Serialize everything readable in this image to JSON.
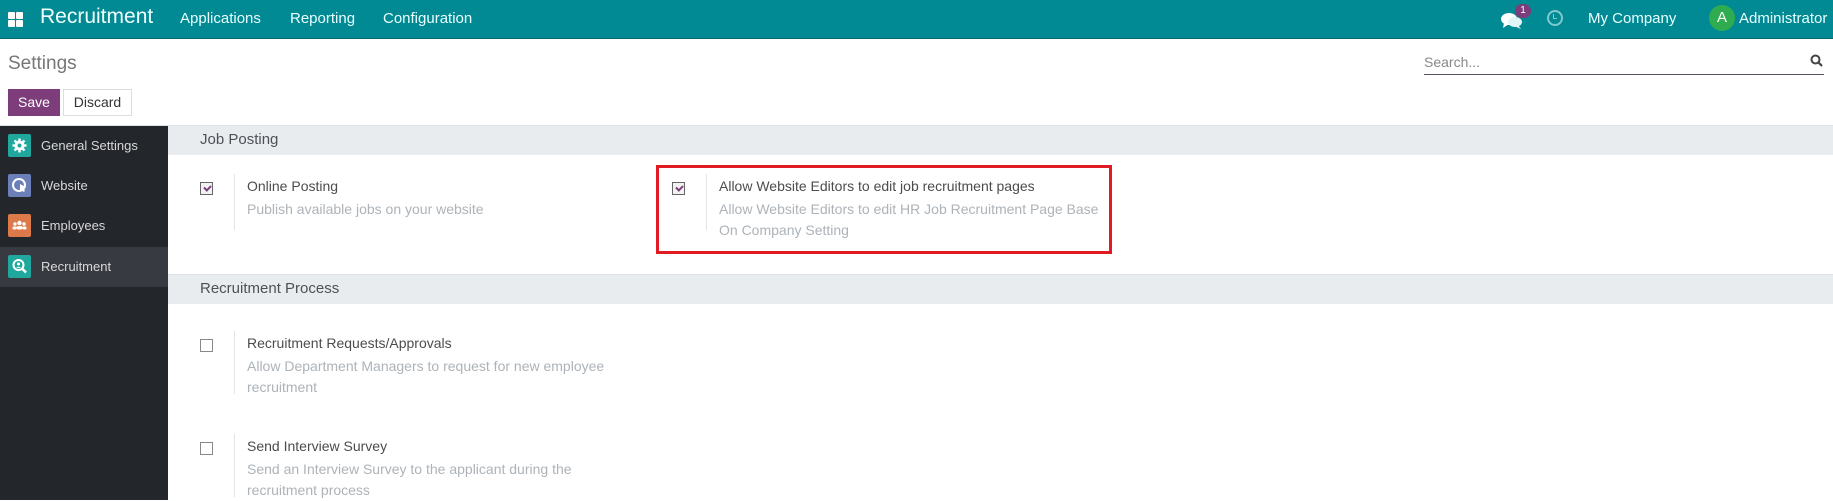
{
  "navbar": {
    "app_name": "Recruitment",
    "menu": [
      "Applications",
      "Reporting",
      "Configuration"
    ],
    "messages_badge": "1",
    "company": "My Company",
    "avatar_letter": "A",
    "user": "Administrator",
    "color": "#018a93"
  },
  "page": {
    "title": "Settings",
    "save_label": "Save",
    "discard_label": "Discard",
    "search_placeholder": "Search..."
  },
  "sidebar": {
    "items": [
      {
        "label": "General Settings",
        "icon": "gear-icon",
        "color": "#20a89f",
        "active": false
      },
      {
        "label": "Website",
        "icon": "globe-cursor-icon",
        "color": "#6b80b8",
        "active": false
      },
      {
        "label": "Employees",
        "icon": "people-icon",
        "color": "#dd7a49",
        "active": false
      },
      {
        "label": "Recruitment",
        "icon": "magnifier-person-icon",
        "color": "#20a89f",
        "active": true
      }
    ]
  },
  "sections": [
    {
      "title": "Job Posting",
      "settings": [
        {
          "title": "Online Posting",
          "description": "Publish available jobs on your website",
          "checked": true
        },
        {
          "title": "Allow Website Editors to edit job recruitment pages",
          "description": "Allow Website Editors to edit HR Job Recruitment Page Base On Company Setting",
          "checked": true,
          "highlighted": true
        }
      ]
    },
    {
      "title": "Recruitment Process",
      "settings": [
        {
          "title": "Recruitment Requests/Approvals",
          "description": "Allow Department Managers to request for new employee recruitment",
          "checked": false
        },
        {
          "title": "Send Interview Survey",
          "description": "Send an Interview Survey to the applicant during the recruitment process",
          "checked": false
        }
      ]
    }
  ]
}
